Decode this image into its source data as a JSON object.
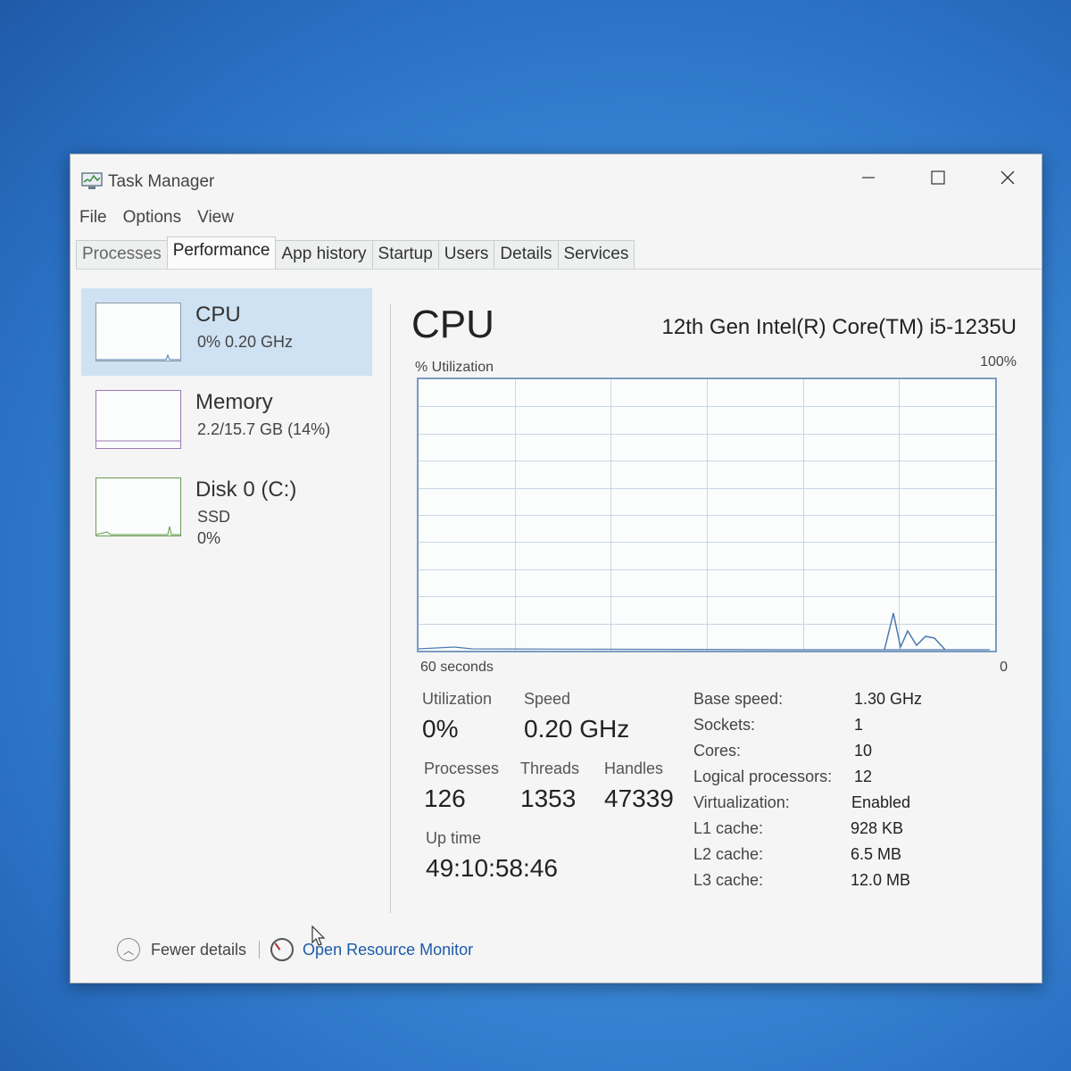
{
  "window": {
    "title": "Task Manager"
  },
  "menu": [
    "File",
    "Options",
    "View"
  ],
  "tabs": [
    "Processes",
    "Performance",
    "App history",
    "Startup",
    "Users",
    "Details",
    "Services"
  ],
  "sidebar": {
    "items": [
      {
        "name": "CPU",
        "sub1": "0% 0.20 GHz",
        "sub2": ""
      },
      {
        "name": "Memory",
        "sub1": "2.2/15.7 GB (14%)",
        "sub2": ""
      },
      {
        "name": "Disk 0 (C:)",
        "sub1": "SSD",
        "sub2": "0%"
      }
    ]
  },
  "main": {
    "title": "CPU",
    "model": "12th Gen Intel(R) Core(TM) i5-1235U",
    "graph": {
      "ylabel": "% Utilization",
      "ymax_label": "100%",
      "xlabel": "60 seconds",
      "xmin_label": "0"
    },
    "stats": {
      "utilization_label": "Utilization",
      "utilization": "0%",
      "speed_label": "Speed",
      "speed": "0.20 GHz",
      "processes_label": "Processes",
      "processes": "126",
      "threads_label": "Threads",
      "threads": "1353",
      "handles_label": "Handles",
      "handles": "47339",
      "uptime_label": "Up time",
      "uptime": "49:10:58:46"
    },
    "specs": [
      {
        "label": "Base speed:",
        "value": "1.30 GHz"
      },
      {
        "label": "Sockets:",
        "value": "1"
      },
      {
        "label": "Cores:",
        "value": "10"
      },
      {
        "label": "Logical processors:",
        "value": "12"
      },
      {
        "label": "Virtualization:",
        "value": "Enabled"
      },
      {
        "label": "L1 cache:",
        "value": "928 KB"
      },
      {
        "label": "L2 cache:",
        "value": "6.5 MB"
      },
      {
        "label": "L3 cache:",
        "value": "12.0 MB"
      }
    ]
  },
  "footer": {
    "fewer_details": "Fewer details",
    "resource_monitor": "Open Resource Monitor"
  },
  "colors": {
    "graph_border": "#7a9cc0",
    "graph_line": "#4a7ab0",
    "selected_bg": "#cfe2f3",
    "link": "#1e5aa8"
  }
}
